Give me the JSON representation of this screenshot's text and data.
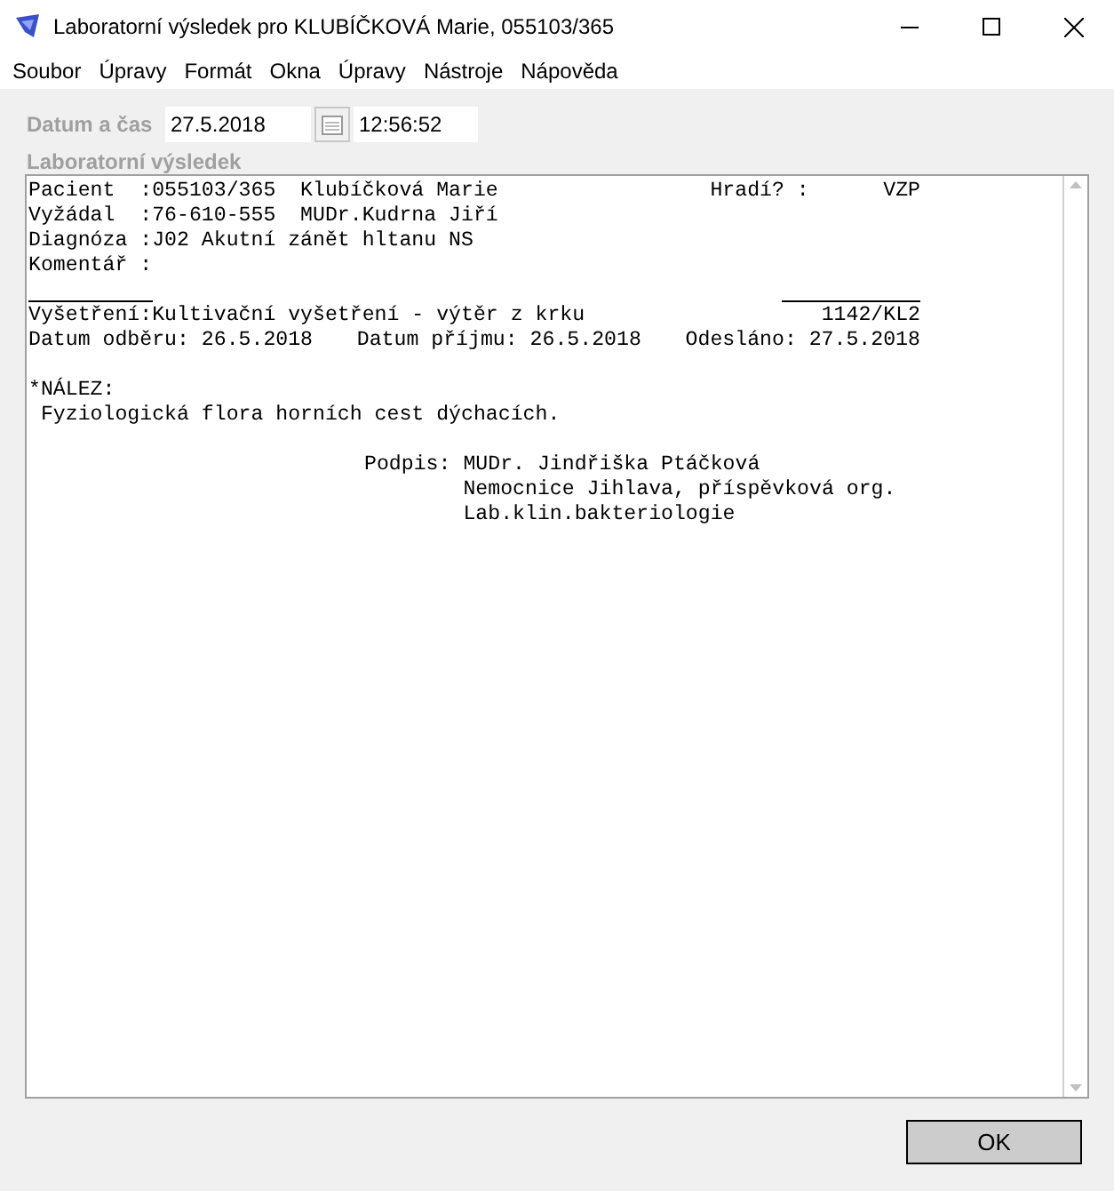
{
  "window": {
    "title": "Laboratorní výsledek pro KLUBÍČKOVÁ Marie, 055103/365"
  },
  "menu": [
    "Soubor",
    "Úpravy",
    "Formát",
    "Okna",
    "Úpravy",
    "Nástroje",
    "Nápověda"
  ],
  "datetime": {
    "label": "Datum a čas",
    "date": "27.5.2018",
    "time": "12:56:52"
  },
  "report": {
    "label": "Laboratorní výsledek",
    "rows": [
      {
        "kind": "text",
        "cells": [
          "Pacient  :055103/365  Klubíčková Marie",
          "Hradí? :      VZP"
        ]
      },
      {
        "kind": "text",
        "cells": [
          "Vyžádal  :76-610-555  MUDr.Kudrna Jiří"
        ]
      },
      {
        "kind": "text",
        "cells": [
          "Diagnóza :J02 Akutní zánět hltanu NS"
        ]
      },
      {
        "kind": "text",
        "cells": [
          "Komentář :"
        ]
      },
      {
        "kind": "rules"
      },
      {
        "kind": "text",
        "cells": [
          "Vyšetření:Kultivační vyšetření - výtěr z krku",
          "1142/KL2"
        ]
      },
      {
        "kind": "text",
        "cells": [
          "Datum odběru: 26.5.2018",
          "Datum příjmu: 26.5.2018",
          "Odesláno: 27.5.2018"
        ]
      },
      {
        "kind": "blank"
      },
      {
        "kind": "text",
        "cells": [
          "*NÁLEZ:"
        ]
      },
      {
        "kind": "text",
        "cells": [
          " Fyziologická flora horních cest dýchacích."
        ]
      },
      {
        "kind": "blank"
      },
      {
        "kind": "signature",
        "label": "Podpis:",
        "lines": [
          "MUDr. Jindřiška Ptáčková",
          "Nemocnice Jihlava, příspěvková org.",
          "Lab.klin.bakteriologie"
        ]
      }
    ]
  },
  "buttons": [
    "OK"
  ]
}
